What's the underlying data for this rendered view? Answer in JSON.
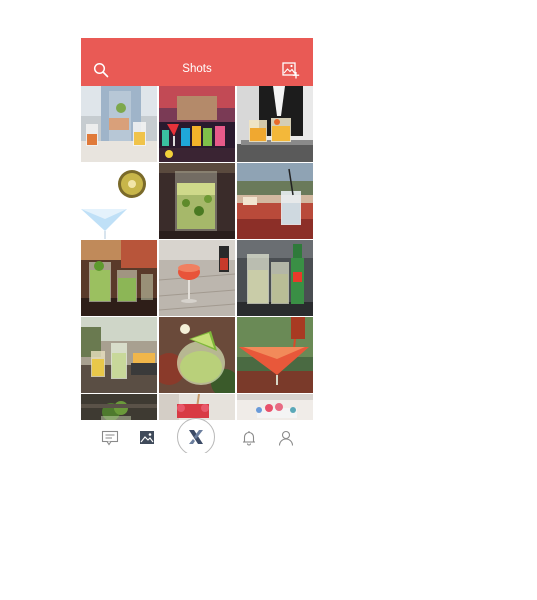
{
  "header": {
    "title": "Shots",
    "search_icon": "search-icon",
    "add_image_icon": "add-image-icon"
  },
  "tabs": [
    {
      "name": "messages",
      "icon": "chat-bubble-icon",
      "active": false
    },
    {
      "name": "shots",
      "icon": "image-icon",
      "active": true
    },
    {
      "name": "home",
      "icon": "x-logo-icon",
      "active": false
    },
    {
      "name": "notifications",
      "icon": "bell-icon",
      "active": false
    },
    {
      "name": "profile",
      "icon": "person-icon",
      "active": false
    }
  ],
  "colors": {
    "brand": "#e95a55",
    "tab_icon": "#8a8a8a",
    "tab_active": "#3f4a5a",
    "logo": "#3b4a66"
  },
  "grid": {
    "columns": 3,
    "items": [
      {
        "subject": "bartender-garnishing-cocktails"
      },
      {
        "subject": "colorful-cocktails-on-bar"
      },
      {
        "subject": "waiter-serving-two-cocktails"
      },
      {
        "subject": "blue-martini-with-kiwi"
      },
      {
        "subject": "mojito-in-glass"
      },
      {
        "subject": "cocktail-on-terrace-table"
      },
      {
        "subject": "mojitos-at-bar"
      },
      {
        "subject": "red-cocktail-on-wooden-table"
      },
      {
        "subject": "lemonade-jars-with-green-bottle"
      },
      {
        "subject": "drinks-on-patio"
      },
      {
        "subject": "lime-margarita"
      },
      {
        "subject": "red-martini-pouring"
      },
      {
        "subject": "herb-cocktail"
      },
      {
        "subject": "red-cocktail-with-straw"
      },
      {
        "subject": "berry-dessert-glasses"
      }
    ]
  }
}
